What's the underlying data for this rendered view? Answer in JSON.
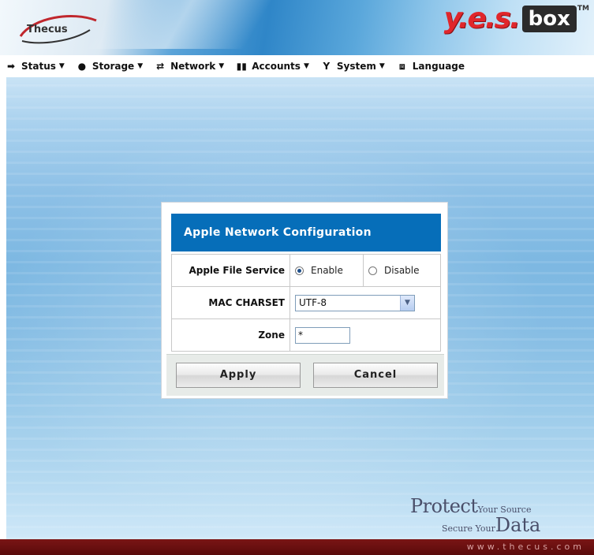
{
  "header": {
    "thecus_logo": "Thecus",
    "yes_logo": "y.e.s.",
    "box_logo": "box",
    "tm": "TM"
  },
  "menu": [
    {
      "label": "Status",
      "icon": "status-icon",
      "arrow": "▼"
    },
    {
      "label": "Storage",
      "icon": "storage-icon",
      "arrow": "▼"
    },
    {
      "label": "Network",
      "icon": "network-icon",
      "arrow": "▼"
    },
    {
      "label": "Accounts",
      "icon": "accounts-icon",
      "arrow": "▼"
    },
    {
      "label": "System",
      "icon": "system-icon",
      "arrow": "▼"
    },
    {
      "label": "Language",
      "icon": "language-icon",
      "arrow": ""
    }
  ],
  "dialog": {
    "title": "Apple Network Configuration",
    "afp_label": "Apple File Service",
    "enable_label": "Enable",
    "disable_label": "Disable",
    "afp_selected": "Enable",
    "charset_label": "MAC CHARSET",
    "charset_value": "UTF-8",
    "zone_label": "Zone",
    "zone_value": "*",
    "apply_label": "Apply",
    "cancel_label": "Cancel"
  },
  "tagline": {
    "protect": "Protect",
    "your_source": "Your Source",
    "secure_your": "Secure Your",
    "data": "Data"
  },
  "footer": {
    "url": "www.thecus.com"
  },
  "colors": {
    "title_bar": "#066eb9",
    "footer": "#6a1010",
    "yes_red": "#e0262b"
  }
}
